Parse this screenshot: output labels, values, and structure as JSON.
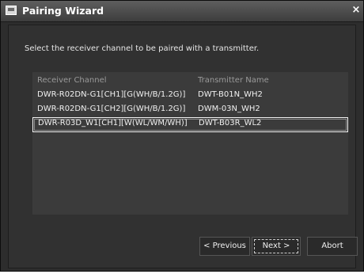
{
  "window": {
    "title": "Pairing Wizard",
    "close_glyph": "×"
  },
  "instruction": "Select the receiver channel to be paired with a transmitter.",
  "table": {
    "headers": [
      "Receiver Channel",
      "Transmitter Name"
    ],
    "rows": [
      {
        "receiver": "DWR-R02DN-G1[CH1][G(WH/B/1.2G)]",
        "transmitter": "DWT-B01N_WH2"
      },
      {
        "receiver": "DWR-R02DN-G1[CH2][G(WH/B/1.2G)]",
        "transmitter": "DWM-03N_WH2"
      },
      {
        "receiver": "DWR-R03D_W1[CH1][W(WL/WM/WH)]",
        "transmitter": "DWT-B03R_WL2"
      }
    ],
    "selected_index": 2
  },
  "buttons": {
    "previous": "< Previous",
    "next": "Next >",
    "abort": "Abort"
  }
}
